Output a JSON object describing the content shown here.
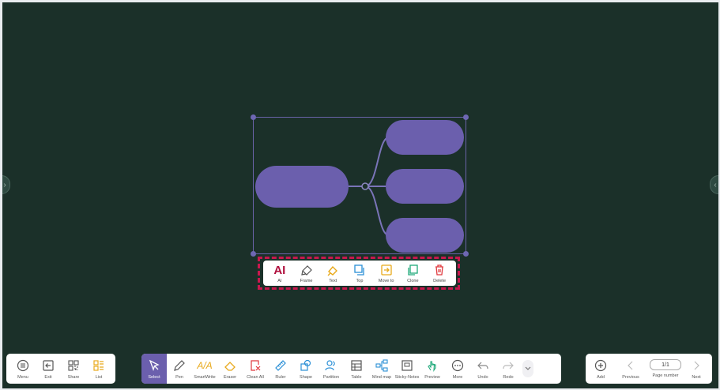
{
  "colors": {
    "background": "#1b3029",
    "accent": "#6b5fad",
    "highlight": "#c8184e"
  },
  "context_toolbar": {
    "items": [
      {
        "label": "AI",
        "icon": "ai-icon"
      },
      {
        "label": "Frame",
        "icon": "frame-icon"
      },
      {
        "label": "Text",
        "icon": "text-fill-icon"
      },
      {
        "label": "Top",
        "icon": "bring-to-top-icon"
      },
      {
        "label": "Move to",
        "icon": "move-to-icon"
      },
      {
        "label": "Clone",
        "icon": "clone-icon"
      },
      {
        "label": "Delete",
        "icon": "trash-icon"
      }
    ]
  },
  "left_toolbar": {
    "items": [
      {
        "label": "Menu",
        "icon": "menu-icon"
      },
      {
        "label": "Exit",
        "icon": "exit-icon"
      },
      {
        "label": "Share",
        "icon": "share-qr-icon"
      },
      {
        "label": "List",
        "icon": "list-icon"
      }
    ]
  },
  "main_toolbar": {
    "items": [
      {
        "label": "Select",
        "icon": "select-cursor-icon"
      },
      {
        "label": "Pen",
        "icon": "pen-icon"
      },
      {
        "label": "SmartWrite",
        "icon": "smartwrite-icon"
      },
      {
        "label": "Eraser",
        "icon": "eraser-icon"
      },
      {
        "label": "Clean All",
        "icon": "clean-all-icon"
      },
      {
        "label": "Ruler",
        "icon": "ruler-icon"
      },
      {
        "label": "Shape",
        "icon": "shape-icon"
      },
      {
        "label": "Partition",
        "icon": "partition-icon"
      },
      {
        "label": "Table",
        "icon": "table-icon"
      },
      {
        "label": "Mind map",
        "icon": "mind-map-icon"
      },
      {
        "label": "Sticky-Notes",
        "icon": "sticky-notes-icon"
      },
      {
        "label": "Preview",
        "icon": "preview-hand-icon"
      },
      {
        "label": "More",
        "icon": "more-icon"
      },
      {
        "label": "Undo",
        "icon": "undo-icon"
      },
      {
        "label": "Redo",
        "icon": "redo-icon"
      }
    ]
  },
  "right_toolbar": {
    "add_label": "Add",
    "previous_label": "Previous",
    "page_number_value": "1/1",
    "page_number_label": "Page number",
    "next_label": "Next"
  }
}
